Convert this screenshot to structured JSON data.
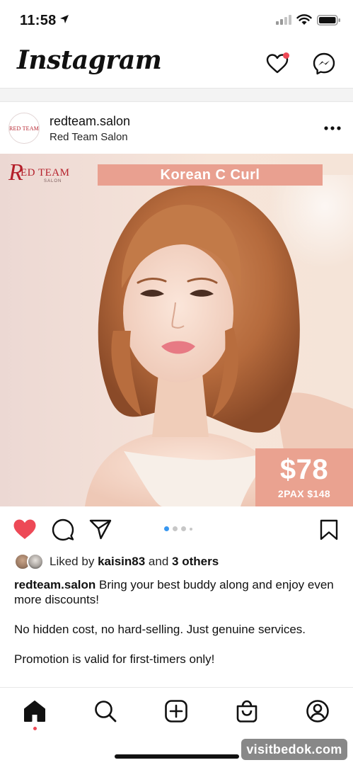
{
  "status_bar": {
    "time": "11:58",
    "icons": [
      "location-arrow-icon",
      "signal-icon",
      "wifi-icon",
      "battery-icon"
    ]
  },
  "header": {
    "logo": "Instagram",
    "icons": [
      "heart-icon",
      "messenger-icon"
    ],
    "notification_color": "#ed4956"
  },
  "post": {
    "avatar_text": "RED TEAM",
    "username": "redteam.salon",
    "location": "Red Team Salon",
    "image": {
      "brand_r": "R",
      "brand_name": "ED TEAM",
      "brand_sub": "SALON",
      "title": "Korean C Curl",
      "price": "$78",
      "price_sub": "2PAX $148",
      "accent_color": "#eaa290"
    },
    "carousel": {
      "count": 4,
      "active": 1
    },
    "likes": {
      "prefix": "Liked by",
      "user": "kaisin83",
      "and": "and",
      "others": "3 others"
    },
    "caption": {
      "user": "redteam.salon",
      "line1": "Bring your best buddy along and enjoy even more discounts!",
      "line2": "No hidden cost, no hard-selling. Just genuine services.",
      "line3": "Promotion is valid for first-timers only!"
    }
  },
  "bottom_nav": {
    "items": [
      "home-icon",
      "search-icon",
      "new-post-icon",
      "shop-icon",
      "profile-icon"
    ],
    "active": "home-icon"
  },
  "watermark": "visitbedok.com",
  "colors": {
    "like_red": "#ed4956",
    "carousel_active": "#3897f0"
  }
}
